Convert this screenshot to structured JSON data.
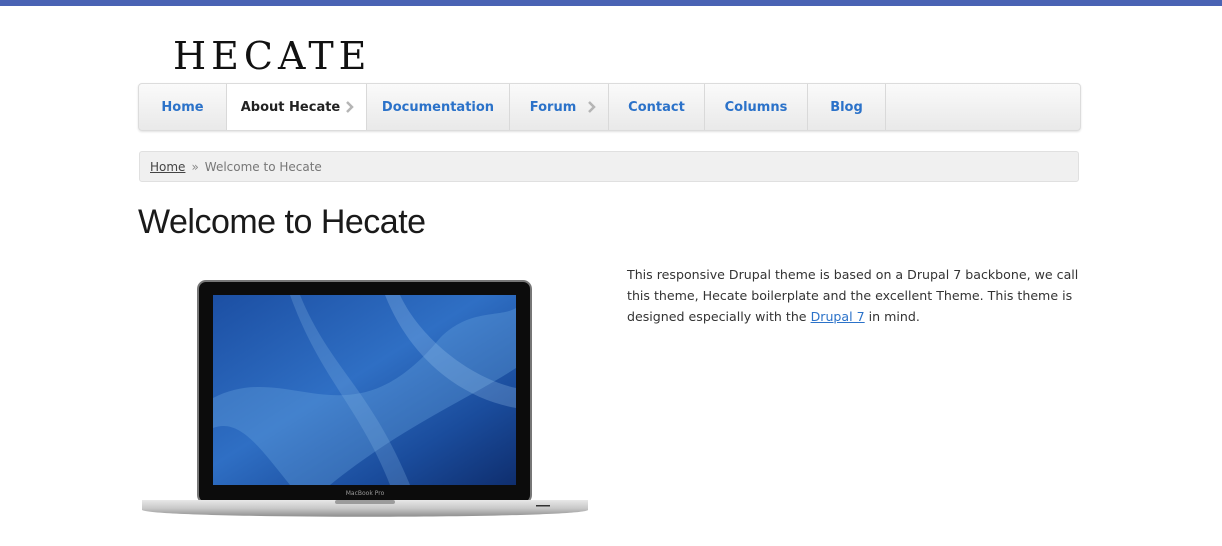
{
  "site": {
    "logo_text": "HECATE"
  },
  "nav": {
    "items": [
      {
        "label": "Home"
      },
      {
        "label": "About Hecate",
        "has_children": true,
        "active": true
      },
      {
        "label": "Documentation"
      },
      {
        "label": "Forum",
        "has_children": true
      },
      {
        "label": "Contact"
      },
      {
        "label": "Columns"
      },
      {
        "label": "Blog"
      }
    ]
  },
  "breadcrumb": {
    "home": "Home",
    "separator": "»",
    "current": "Welcome to Hecate"
  },
  "page": {
    "title": "Welcome to Hecate",
    "image_label": "MacBook Pro",
    "body": {
      "text_before_link": "This responsive Drupal theme is based on a Drupal 7 backbone, we call this theme, Hecate boilerplate and the excellent Theme. This theme is designed especially with the ",
      "link_text": "Drupal 7",
      "text_after_link": " in mind."
    }
  },
  "colors": {
    "top_strip": "#4a63b4",
    "link": "#2b72c9"
  }
}
